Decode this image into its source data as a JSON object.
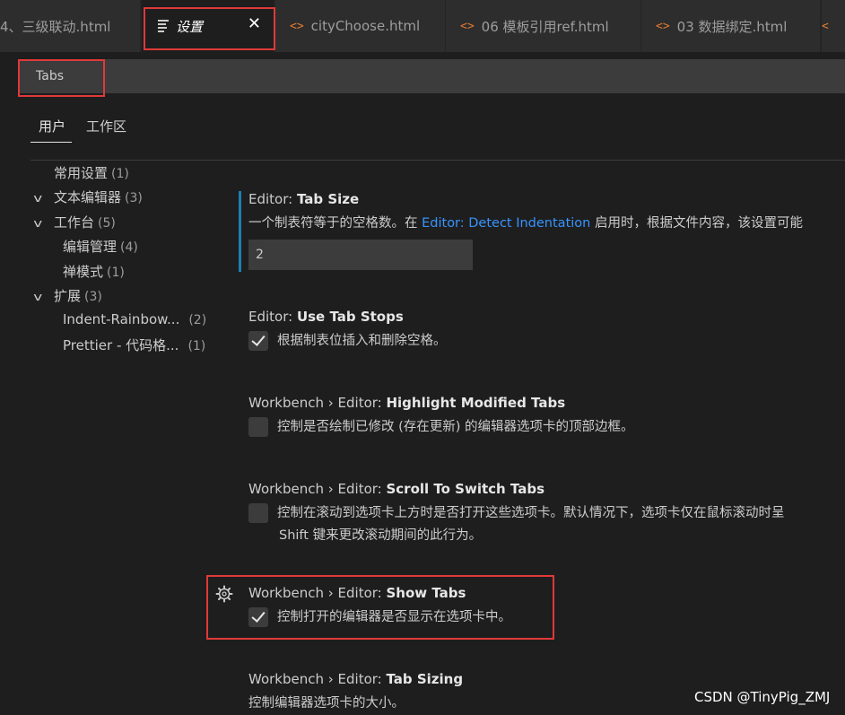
{
  "tabs": [
    {
      "label": "4、三级联动.html",
      "icon": "html-code-icon"
    },
    {
      "label": "设置",
      "icon": "settings-lines-icon",
      "active": true,
      "close": "✕"
    },
    {
      "label": "cityChoose.html",
      "icon": "html-code-icon"
    },
    {
      "label": "06 模板引用ref.html",
      "icon": "html-code-icon"
    },
    {
      "label": "03 数据绑定.html",
      "icon": "html-code-icon"
    }
  ],
  "search": {
    "value": "Tabs"
  },
  "scope": {
    "user": "用户",
    "workspace": "工作区"
  },
  "toc": [
    {
      "label": "常用设置",
      "count": "(1)"
    },
    {
      "label": "文本编辑器",
      "count": "(3)"
    },
    {
      "label": "工作台",
      "count": "(5)"
    },
    {
      "label": "编辑管理",
      "count": "(4)"
    },
    {
      "label": "禅模式",
      "count": "(1)"
    },
    {
      "label": "扩展",
      "count": "(3)"
    },
    {
      "label": "Indent-Rainbow...",
      "count": "(2)"
    },
    {
      "label": "Prettier - 代码格...",
      "count": "(1)"
    }
  ],
  "settings": {
    "tab_size": {
      "category": "Editor: ",
      "name": "Tab Size",
      "desc_before": "一个制表符等于的空格数。在 ",
      "desc_link": "Editor: Detect Indentation",
      "desc_after": " 启用时，根据文件内容，该设置可能",
      "value": "2"
    },
    "use_tab_stops": {
      "category": "Editor: ",
      "name": "Use Tab Stops",
      "desc": "根据制表位插入和删除空格。",
      "checked": true
    },
    "highlight_modified": {
      "category": "Workbench › Editor: ",
      "name": "Highlight Modified Tabs",
      "desc": "控制是否绘制已修改 (存在更新) 的编辑器选项卡的顶部边框。",
      "checked": false
    },
    "scroll_to_switch": {
      "category": "Workbench › Editor: ",
      "name": "Scroll To Switch Tabs",
      "desc_line1": "控制在滚动到选项卡上方时是否打开这些选项卡。默认情况下，选项卡仅在鼠标滚动时呈",
      "desc_line2": "Shift 键来更改滚动期间的此行为。",
      "checked": false
    },
    "show_tabs": {
      "category": "Workbench › Editor: ",
      "name": "Show Tabs",
      "desc": "控制打开的编辑器是否显示在选项卡中。",
      "checked": true
    },
    "tab_sizing": {
      "category": "Workbench › Editor: ",
      "name": "Tab Sizing",
      "desc": "控制编辑器选项卡的大小。"
    }
  },
  "watermark": "CSDN @TinyPig_ZMJ",
  "colors": {
    "highlight_box": "#e0393a",
    "link": "#3794ff",
    "html_icon": "#e37933"
  }
}
